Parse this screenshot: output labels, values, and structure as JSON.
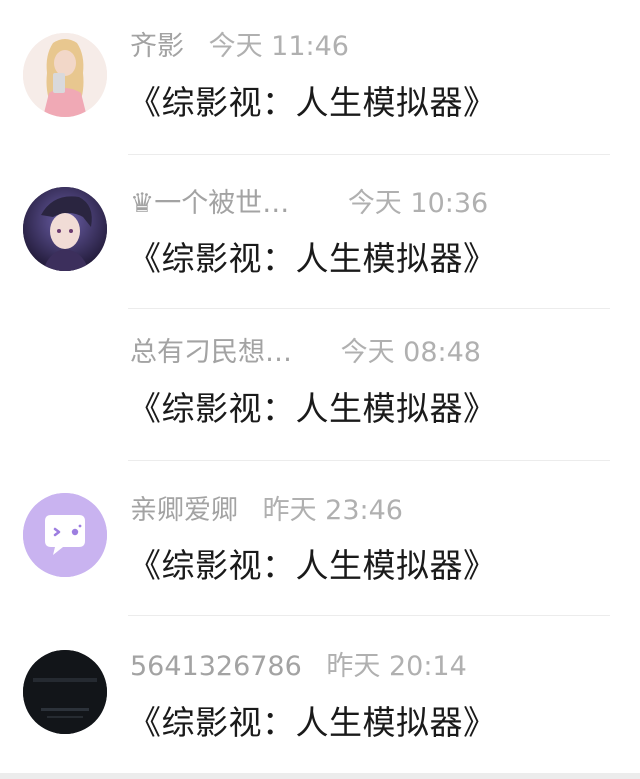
{
  "messages": [
    {
      "name": "齐影",
      "time": "今天 11:46",
      "text": "《综影视：人生模拟器》",
      "avatar": "girl-photo-avatar"
    },
    {
      "name": "♛一个被世…",
      "time": "今天 10:36",
      "text": "《综影视：人生模拟器》",
      "avatar": "anime-boy-avatar"
    },
    {
      "name": "总有刁民想…",
      "time": "今天 08:48",
      "text": "《综影视：人生模拟器》",
      "avatar": ""
    },
    {
      "name": "亲卿爱卿",
      "time": "昨天 23:46",
      "text": "《综影视：人生模拟器》",
      "avatar": "wink-chat-bubble-avatar"
    },
    {
      "name": "5641326786",
      "time": "昨天 20:14",
      "text": "《综影视：人生模拟器》",
      "avatar": "dark-photo-avatar"
    }
  ],
  "colors": {
    "name_gray": "#a3a3a3",
    "time_gray": "#b0b0b0",
    "message_black": "#1a1a1a",
    "divider": "#ececec",
    "purple_avatar": "#c9b3f0"
  }
}
